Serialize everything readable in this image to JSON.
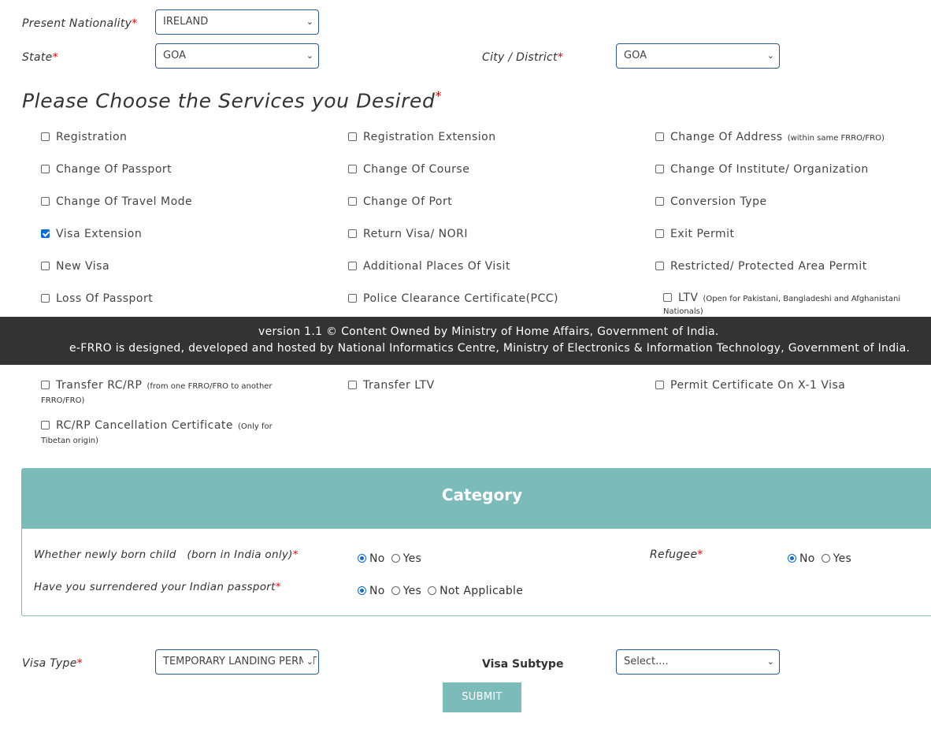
{
  "nationality": {
    "label": "Present Nationality",
    "value": "IRELAND"
  },
  "state": {
    "label": "State",
    "value": "GOA"
  },
  "city": {
    "label": "City / District",
    "value": "GOA"
  },
  "required_mark": "*",
  "services": {
    "heading": "Please Choose the Services you Desired",
    "items": [
      {
        "label": "Registration",
        "checked": false
      },
      {
        "label": "Registration Extension",
        "checked": false
      },
      {
        "label": "Change Of Address",
        "note": "(within same FRRO/FRO)",
        "checked": false
      },
      {
        "label": "Change Of Passport",
        "checked": false
      },
      {
        "label": "Change Of Course",
        "checked": false
      },
      {
        "label": "Change Of Institute/ Organization",
        "checked": false
      },
      {
        "label": "Change Of Travel Mode",
        "checked": false
      },
      {
        "label": "Change Of Port",
        "checked": false
      },
      {
        "label": "Conversion Type",
        "checked": false
      },
      {
        "label": "Visa Extension",
        "checked": true
      },
      {
        "label": "Return Visa/ NORI",
        "checked": false
      },
      {
        "label": "Exit Permit",
        "checked": false
      },
      {
        "label": "New Visa",
        "checked": false
      },
      {
        "label": "Additional Places Of Visit",
        "checked": false
      },
      {
        "label": "Restricted/ Protected Area Permit",
        "checked": false
      },
      {
        "label": "Loss Of Passport",
        "checked": false
      },
      {
        "label": "Police Clearance Certificate(PCC)",
        "checked": false
      },
      {
        "label": "LTV",
        "note": "(Open for Pakistani, Bangladeshi and Afghanistani Nationals)",
        "checked": false
      }
    ],
    "items_lower": [
      {
        "label": "Transfer RC/RP",
        "note": "(from one FRRO/FRO to another FRRO/FRO)",
        "checked": false
      },
      {
        "label": "Transfer LTV",
        "checked": false
      },
      {
        "label": "Permit Certificate On X-1 Visa",
        "checked": false
      },
      {
        "label": "RC/RP Cancellation Certificate",
        "note": "(Only for Tibetan origin)",
        "checked": false
      }
    ]
  },
  "footer": {
    "line1": "version 1.1 © Content Owned by Ministry of Home Affairs, Government of India.",
    "line2": "e-FRRO is designed, developed and hosted by National Informatics Centre, Ministry of Electronics & Information Technology, Government of India."
  },
  "category": {
    "title": "Category",
    "newborn": {
      "label": "Whether newly born child   (born in India only)",
      "options": [
        "No",
        "Yes"
      ],
      "selected": "No"
    },
    "refugee": {
      "label": "Refugee",
      "options": [
        "No",
        "Yes"
      ],
      "selected": "No"
    },
    "surrendered": {
      "label": "Have you surrendered your Indian passport",
      "options": [
        "No",
        "Yes",
        "Not Applicable"
      ],
      "selected": "No"
    }
  },
  "visa_type": {
    "label": "Visa Type",
    "value": "TEMPORARY LANDING PERMIT"
  },
  "visa_subtype": {
    "label": "Visa Subtype",
    "value": "Select...."
  },
  "submit": "SUBMIT",
  "colors": {
    "accent": "#7bbcbb",
    "footer": "#333333",
    "required": "#ee0000",
    "checkbox": "#0a6ad8"
  }
}
